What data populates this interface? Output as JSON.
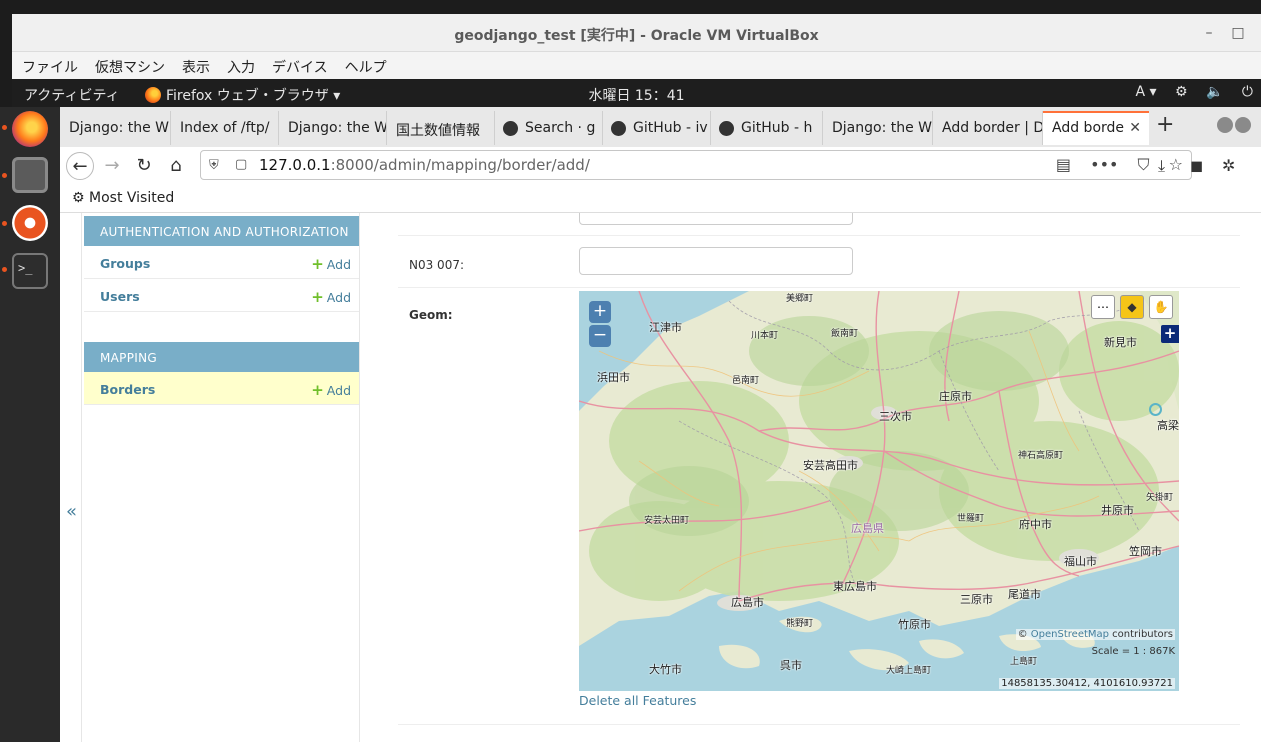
{
  "vbox": {
    "title": "geodjango_test [実行中] - Oracle VM VirtualBox",
    "min": "–",
    "max": "□",
    "menu": [
      "ファイル",
      "仮想マシン",
      "表示",
      "入力",
      "デバイス",
      "ヘルプ"
    ]
  },
  "topbar": {
    "activities": "アクティビティ",
    "app": "Firefox ウェブ・ブラウザ ▾",
    "clock": "水曜日 15：41",
    "input_method": "A ▾",
    "network_icon": "⚙",
    "volume_icon": "🔈",
    "power_icon": "⏻"
  },
  "tabs": [
    {
      "label": "Django: the W",
      "icon": "none"
    },
    {
      "label": "Index of /ftp/",
      "icon": "none"
    },
    {
      "label": "Django: the W",
      "icon": "none"
    },
    {
      "label": "国土数値情報",
      "icon": "none"
    },
    {
      "label": "Search · g",
      "icon": "github-icon"
    },
    {
      "label": "GitHub - iv",
      "icon": "github-icon"
    },
    {
      "label": "GitHub - h",
      "icon": "github-icon"
    },
    {
      "label": "Django: the W",
      "icon": "none"
    },
    {
      "label": "Add border | D",
      "icon": "none"
    },
    {
      "label": "Add borde",
      "icon": "none",
      "active": true,
      "close": "✕"
    }
  ],
  "newtab": "+",
  "nav": {
    "back": "←",
    "forward": "→",
    "reload": "↻",
    "home": "⌂",
    "url_host": "127.0.0.1",
    "url_path": ":8000/admin/mapping/border/add/",
    "reader": "▤",
    "more": "•••",
    "pocket": "⛉",
    "star": "☆",
    "download": "⤓",
    "ext": "◼",
    "ext2": "✲"
  },
  "bookmarks": {
    "most_visited": "⚙ Most Visited"
  },
  "sidebar": {
    "toggle": "«",
    "auth": {
      "caption": "AUTHENTICATION AND AUTHORIZATION",
      "rows": [
        {
          "label": "Groups",
          "add": "Add"
        },
        {
          "label": "Users",
          "add": "Add"
        }
      ]
    },
    "mapping": {
      "caption": "MAPPING",
      "rows": [
        {
          "label": "Borders",
          "add": "Add"
        }
      ]
    },
    "add_plus": "+"
  },
  "form": {
    "n03_007_label": "N03 007:",
    "geom_label": "Geom:",
    "delete_all": "Delete all Features"
  },
  "map": {
    "zoom_in": "+",
    "zoom_out": "−",
    "tool_point": "⋯",
    "tool_poly": "◆",
    "tool_pan": "✋",
    "layer_switch": "+",
    "attribution_c": "© ",
    "attribution_osm": "OpenStreetMap",
    "attribution_rest": " contributors",
    "scale": "Scale = 1 : 867K",
    "coords": "14858135.30412, 4101610.93721",
    "labels": [
      {
        "t": "美郷町",
        "cls": "small"
      },
      {
        "t": "江津市",
        "cls": ""
      },
      {
        "t": "川本町",
        "cls": "small"
      },
      {
        "t": "飯南町",
        "cls": "small"
      },
      {
        "t": "新見市",
        "cls": ""
      },
      {
        "t": "浜田市",
        "cls": ""
      },
      {
        "t": "邑南町",
        "cls": "small"
      },
      {
        "t": "庄原市",
        "cls": ""
      },
      {
        "t": "三次市",
        "cls": ""
      },
      {
        "t": "高梁",
        "cls": ""
      },
      {
        "t": "神石高原町",
        "cls": "small"
      },
      {
        "t": "安芸高田市",
        "cls": ""
      },
      {
        "t": "矢掛町",
        "cls": "small"
      },
      {
        "t": "安芸太田町",
        "cls": "small"
      },
      {
        "t": "世羅町",
        "cls": "small"
      },
      {
        "t": "府中市",
        "cls": ""
      },
      {
        "t": "井原市",
        "cls": ""
      },
      {
        "t": "広島県",
        "cls": "pref"
      },
      {
        "t": "笠岡市",
        "cls": ""
      },
      {
        "t": "福山市",
        "cls": ""
      },
      {
        "t": "東広島市",
        "cls": ""
      },
      {
        "t": "三原市",
        "cls": ""
      },
      {
        "t": "尾道市",
        "cls": ""
      },
      {
        "t": "広島市",
        "cls": ""
      },
      {
        "t": "熊野町",
        "cls": "small"
      },
      {
        "t": "竹原市",
        "cls": ""
      },
      {
        "t": "呉市",
        "cls": ""
      },
      {
        "t": "上島町",
        "cls": "small"
      },
      {
        "t": "大竹市",
        "cls": ""
      },
      {
        "t": "大崎上島町",
        "cls": "small"
      }
    ]
  }
}
